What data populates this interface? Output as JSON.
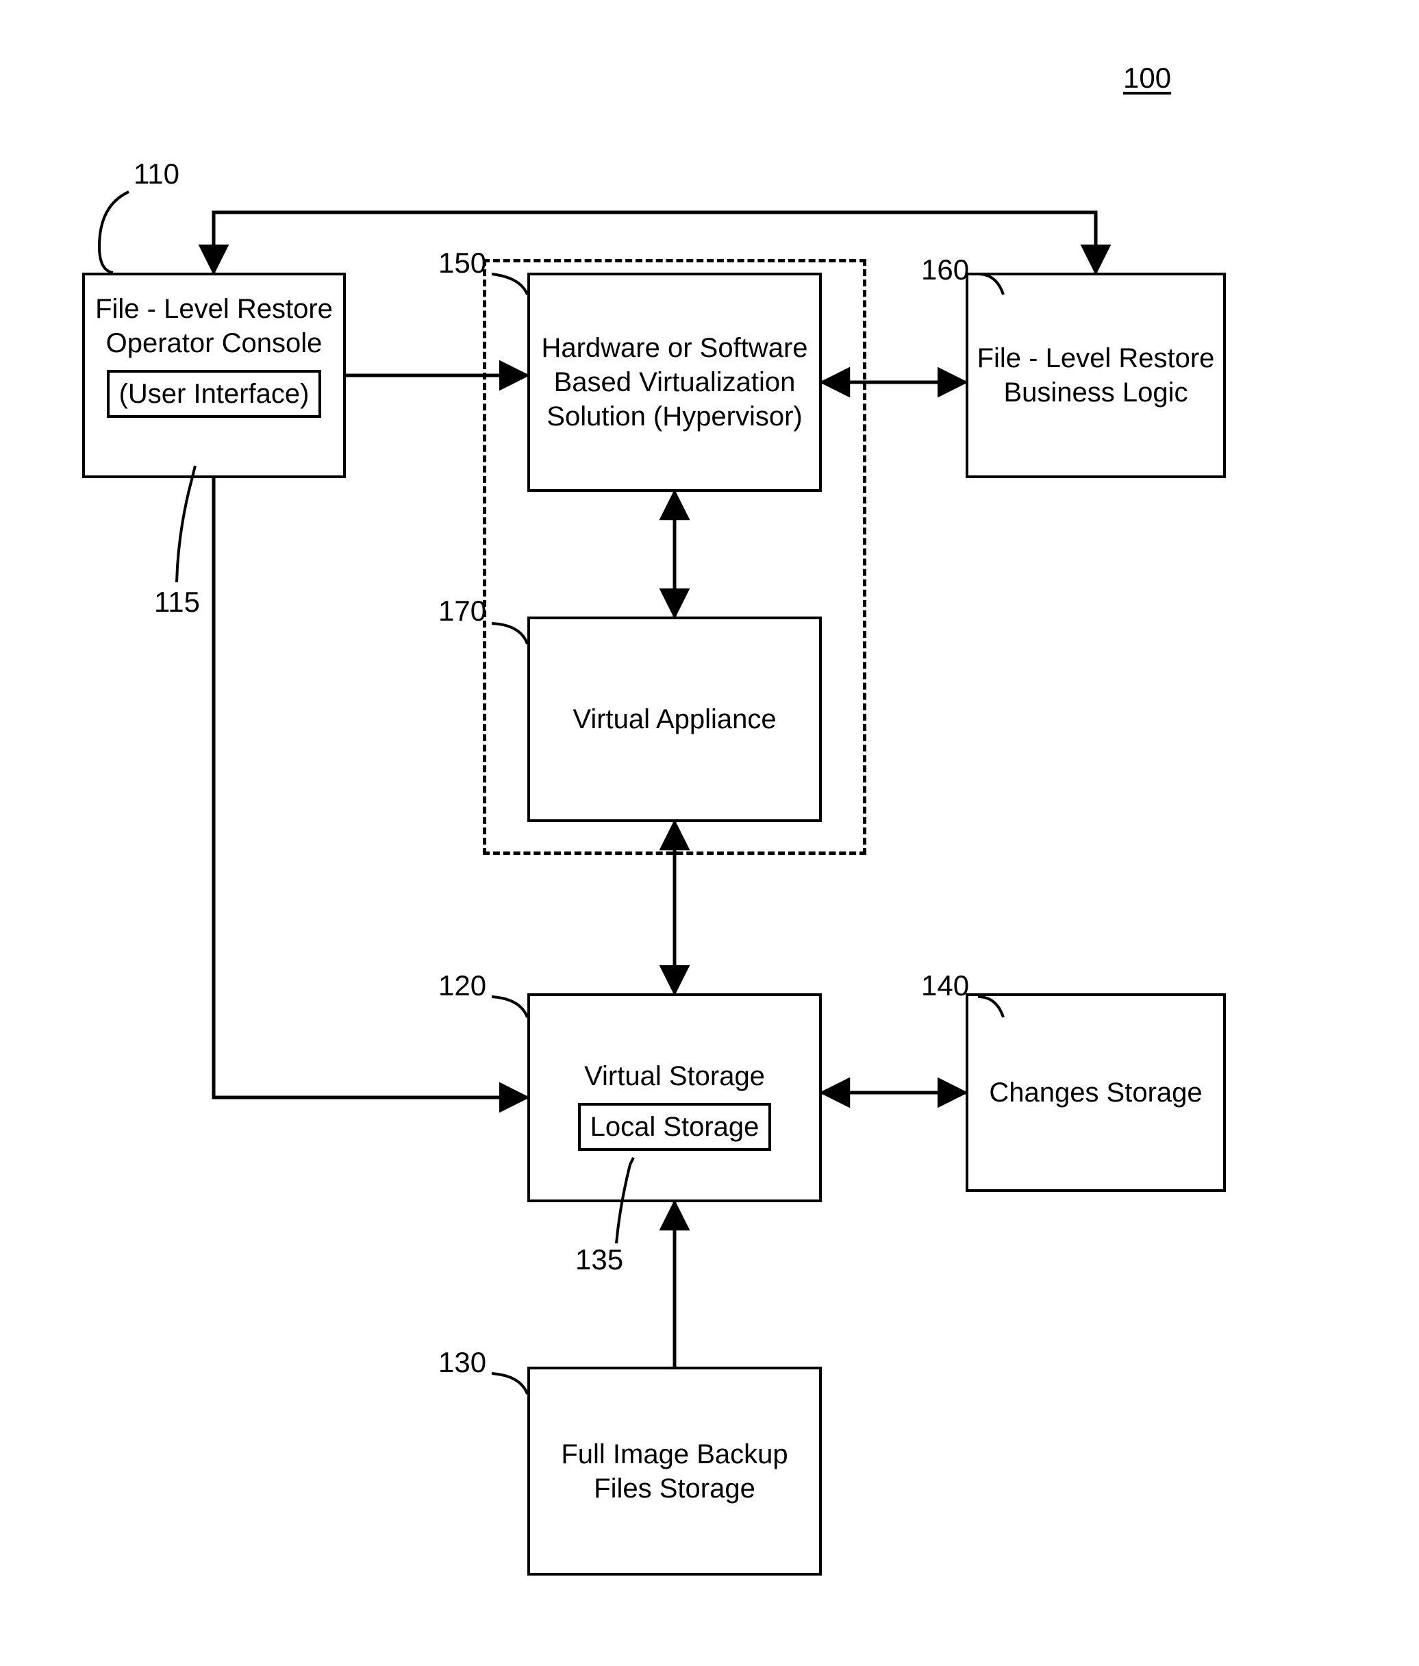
{
  "figure_number": "100",
  "boxes": {
    "console": {
      "ref": "110",
      "title": "File - Level Restore Operator Console",
      "inner_ref": "115",
      "inner_label": "(User Interface)"
    },
    "hypervisor": {
      "ref": "150",
      "title": "Hardware or Software Based Virtualization Solution (Hypervisor)"
    },
    "business_logic": {
      "ref": "160",
      "title": "File - Level Restore Business Logic"
    },
    "virtual_appliance": {
      "ref": "170",
      "title": "Virtual Appliance"
    },
    "virtual_storage": {
      "ref": "120",
      "title": "Virtual Storage",
      "inner_ref": "135",
      "inner_label": "Local Storage"
    },
    "changes_storage": {
      "ref": "140",
      "title": "Changes Storage"
    },
    "backup_storage": {
      "ref": "130",
      "title": "Full Image Backup Files Storage"
    }
  }
}
